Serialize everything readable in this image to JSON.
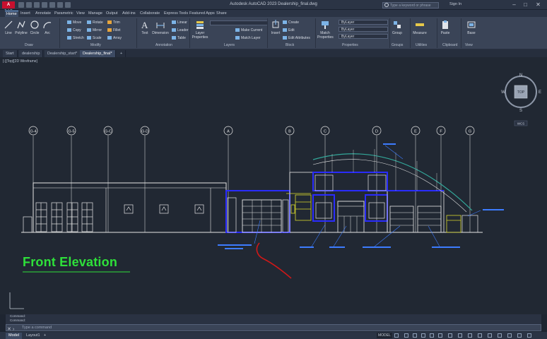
{
  "titlebar": {
    "logo": "A CAD",
    "title": "Autodesk AutoCAD 2023   Dealership_final.dwg",
    "search_placeholder": "Type a keyword or phrase",
    "user": "Sign In"
  },
  "menu": [
    "Home",
    "Insert",
    "Annotate",
    "Parametric",
    "View",
    "Manage",
    "Output",
    "Add-ins",
    "Collaborate",
    "Express Tools",
    "Featured Apps",
    "Share"
  ],
  "ribbon": {
    "draw": {
      "label": "Draw",
      "tools": [
        "Line",
        "Polyline",
        "Circle",
        "Arc"
      ]
    },
    "modify": {
      "label": "Modify",
      "tools": [
        "Move",
        "Rotate",
        "Trim",
        "Copy",
        "Mirror",
        "Fillet",
        "Stretch",
        "Scale",
        "Array"
      ]
    },
    "annotation": {
      "label": "Annotation",
      "tools": [
        "Text",
        "Dimension",
        "Linear",
        "Leader",
        "Table"
      ]
    },
    "layers": {
      "label": "Layers",
      "tools": [
        "Layer Properties",
        "Make Current",
        "Match Layer"
      ]
    },
    "block": {
      "label": "Block",
      "tools": [
        "Insert",
        "Create",
        "Edit",
        "Edit Attributes"
      ]
    },
    "properties": {
      "label": "Properties",
      "tools": [
        "Match Properties"
      ],
      "bylayer": "ByLayer"
    },
    "groups": {
      "label": "Groups",
      "tools": [
        "Group"
      ]
    },
    "utilities": {
      "label": "Utilities",
      "tools": [
        "Measure"
      ]
    },
    "clipboard": {
      "label": "Clipboard",
      "tools": [
        "Paste"
      ]
    },
    "view": {
      "label": "View",
      "tools": [
        "Base"
      ]
    }
  },
  "file_tabs": [
    "Start",
    "dealership",
    "Dealership_start*",
    "Dealership_final*"
  ],
  "viewport": {
    "label": "[-][Top][2D Wireframe]"
  },
  "navcube": {
    "north": "N",
    "south": "S",
    "east": "E",
    "west": "W",
    "face": "TOP",
    "ucs": "WCS"
  },
  "drawing": {
    "title": "Front Elevation",
    "grid_labels": [
      "G-4",
      "G-5",
      "G-C",
      "G-D",
      "A",
      "B",
      "C",
      "D",
      "E",
      "F",
      "G"
    ],
    "annotation_color": "#3d7cff",
    "linework_color": "#e6e6e6",
    "highlight_color": "#2a2cff",
    "detail_color": "#d9d92e",
    "title_color": "#2ee03a",
    "markup_color": "#d01818"
  },
  "command": {
    "history": [
      "Command:",
      "Command:"
    ],
    "placeholder": "Type a command"
  },
  "status": {
    "tabs": [
      "Model",
      "Layout1"
    ],
    "space": "MODEL"
  }
}
